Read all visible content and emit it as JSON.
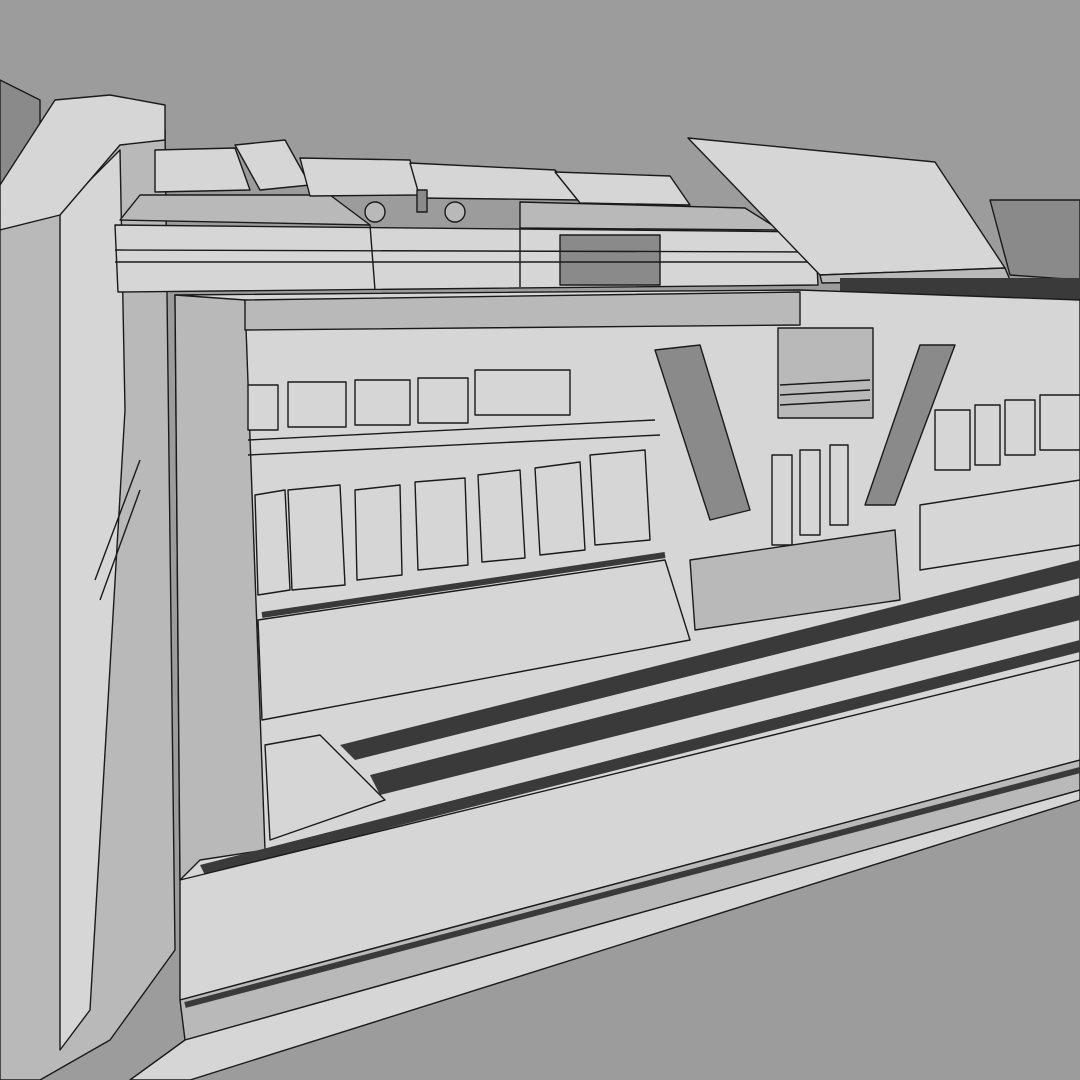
{
  "scene": {
    "subject": "sci-fi-wall-panel-wireframe-render",
    "background_color": "#9c9c9c",
    "surface_light": "#d6d6d6",
    "surface_mid": "#b9b9b9",
    "surface_dark": "#8a8a8a",
    "edge_color": "#1a1a1a",
    "shadow_color": "#3a3a3a"
  }
}
